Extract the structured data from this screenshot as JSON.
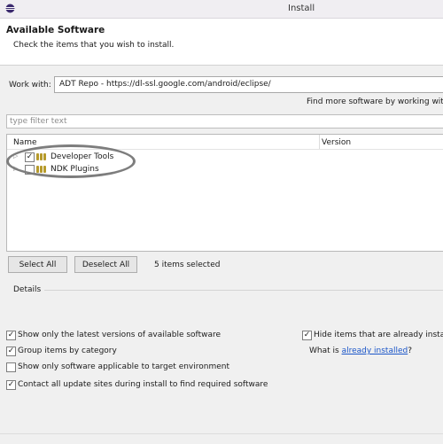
{
  "window": {
    "title": "Install"
  },
  "header": {
    "title": "Available Software",
    "description": "Check the items that you wish to install."
  },
  "work_with": {
    "label": "Work with:",
    "value": "ADT Repo - https://dl-ssl.google.com/android/eclipse/",
    "find_more": "Find more software by working with th"
  },
  "filter": {
    "placeholder": "type filter text"
  },
  "tree": {
    "columns": [
      "Name",
      "Version"
    ],
    "items": [
      {
        "label": "Developer Tools",
        "checked": true
      },
      {
        "label": "NDK Plugins",
        "checked": false
      }
    ]
  },
  "buttons": {
    "select_all": "Select All",
    "deselect_all": "Deselect All"
  },
  "status": {
    "items_selected": "5 items selected"
  },
  "details": {
    "label": "Details"
  },
  "options": {
    "latest_versions": {
      "label": "Show only the latest versions of available software",
      "checked": true
    },
    "group_by_category": {
      "label": "Group items by category",
      "checked": true
    },
    "applicable_only": {
      "label": "Show only software applicable to target environment",
      "checked": false
    },
    "contact_sites": {
      "label": "Contact all update sites during install to find required software",
      "checked": true
    },
    "hide_installed": {
      "label": "Hide items that are already installed",
      "checked": true
    },
    "what_is": {
      "prefix": "What is ",
      "link": "already installed",
      "suffix": "?"
    }
  },
  "colors": {
    "link": "#1a55c8",
    "highlight_ring": "#7d7d7d",
    "package_icon": "#b69a2a"
  },
  "icons": {
    "app": "eclipse-icon",
    "package": "package-icon",
    "expander": "expander-icon"
  }
}
